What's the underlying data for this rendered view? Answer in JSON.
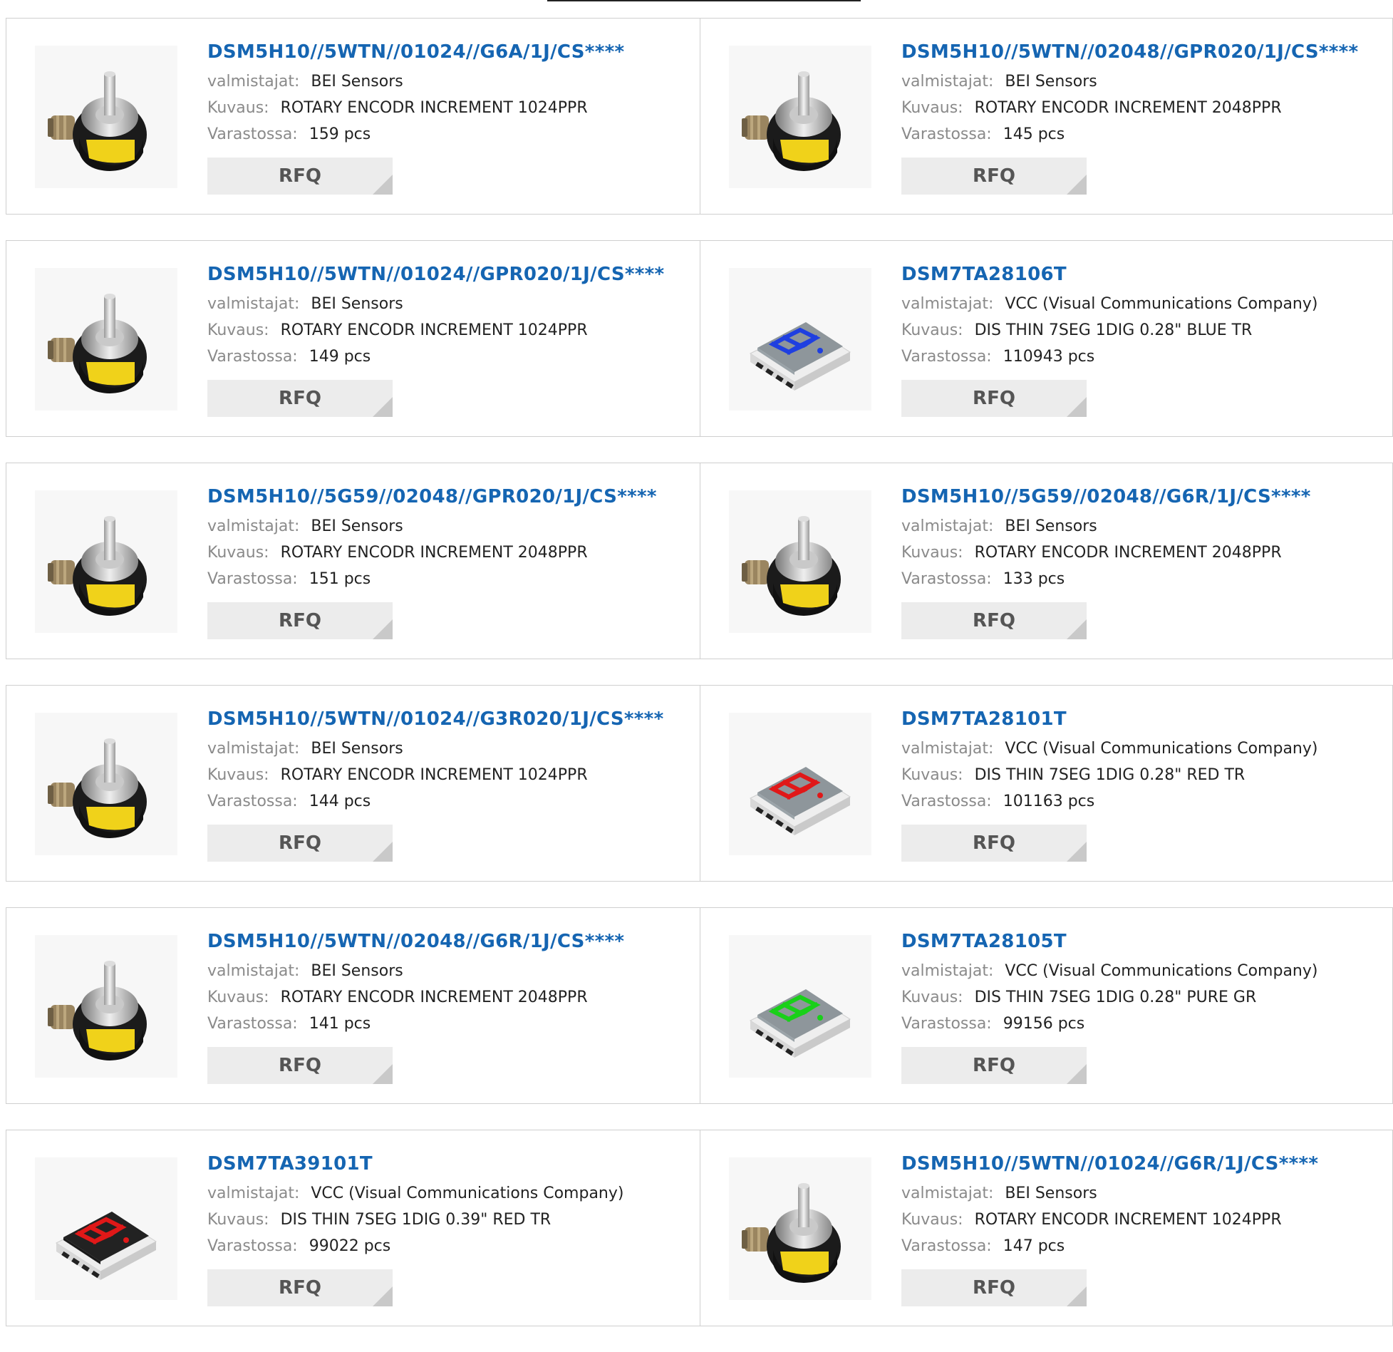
{
  "labels": {
    "manufacturer": "valmistajat:",
    "description": "Kuvaus:",
    "stock": "Varastossa:",
    "rfq": "RFQ"
  },
  "products": [
    {
      "part": "DSM5H10//5WTN//01024//G6A/1J/CS****",
      "manufacturer": "BEI Sensors",
      "description": "ROTARY ENCODR INCREMENT 1024PPR",
      "stock": "159 pcs",
      "image": "rotary-encoder-image"
    },
    {
      "part": "DSM5H10//5WTN//02048//GPR020/1J/CS****",
      "manufacturer": "BEI Sensors",
      "description": "ROTARY ENCODR INCREMENT 2048PPR",
      "stock": "145 pcs",
      "image": "rotary-encoder-image"
    },
    {
      "part": "DSM5H10//5WTN//01024//GPR020/1J/CS****",
      "manufacturer": "BEI Sensors",
      "description": "ROTARY ENCODR INCREMENT 1024PPR",
      "stock": "149 pcs",
      "image": "rotary-encoder-image"
    },
    {
      "part": "DSM7TA28106T",
      "manufacturer": "VCC (Visual Communications Company)",
      "description": "DIS THIN 7SEG 1DIG 0.28\" BLUE TR",
      "stock": "110943 pcs",
      "image": "seven-segment-display-image",
      "color": "#1f3fe0"
    },
    {
      "part": "DSM5H10//5G59//02048//GPR020/1J/CS****",
      "manufacturer": "BEI Sensors",
      "description": "ROTARY ENCODR INCREMENT 2048PPR",
      "stock": "151 pcs",
      "image": "rotary-encoder-image"
    },
    {
      "part": "DSM5H10//5G59//02048//G6R/1J/CS****",
      "manufacturer": "BEI Sensors",
      "description": "ROTARY ENCODR INCREMENT 2048PPR",
      "stock": "133 pcs",
      "image": "rotary-encoder-image"
    },
    {
      "part": "DSM5H10//5WTN//01024//G3R020/1J/CS****",
      "manufacturer": "BEI Sensors",
      "description": "ROTARY ENCODR INCREMENT 1024PPR",
      "stock": "144 pcs",
      "image": "rotary-encoder-image"
    },
    {
      "part": "DSM7TA28101T",
      "manufacturer": "VCC (Visual Communications Company)",
      "description": "DIS THIN 7SEG 1DIG 0.28\" RED TR",
      "stock": "101163 pcs",
      "image": "seven-segment-display-image",
      "color": "#e01818"
    },
    {
      "part": "DSM5H10//5WTN//02048//G6R/1J/CS****",
      "manufacturer": "BEI Sensors",
      "description": "ROTARY ENCODR INCREMENT 2048PPR",
      "stock": "141 pcs",
      "image": "rotary-encoder-image"
    },
    {
      "part": "DSM7TA28105T",
      "manufacturer": "VCC (Visual Communications Company)",
      "description": "DIS THIN 7SEG 1DIG 0.28\" PURE GR",
      "stock": "99156 pcs",
      "image": "seven-segment-display-image",
      "color": "#19d019"
    },
    {
      "part": "DSM7TA39101T",
      "manufacturer": "VCC (Visual Communications Company)",
      "description": "DIS THIN 7SEG 1DIG 0.39\" RED TR",
      "stock": "99022 pcs",
      "image": "seven-segment-display-dark-image",
      "color": "#e01818"
    },
    {
      "part": "DSM5H10//5WTN//01024//G6R/1J/CS****",
      "manufacturer": "BEI Sensors",
      "description": "ROTARY ENCODR INCREMENT 1024PPR",
      "stock": "147 pcs",
      "image": "rotary-encoder-image"
    }
  ]
}
